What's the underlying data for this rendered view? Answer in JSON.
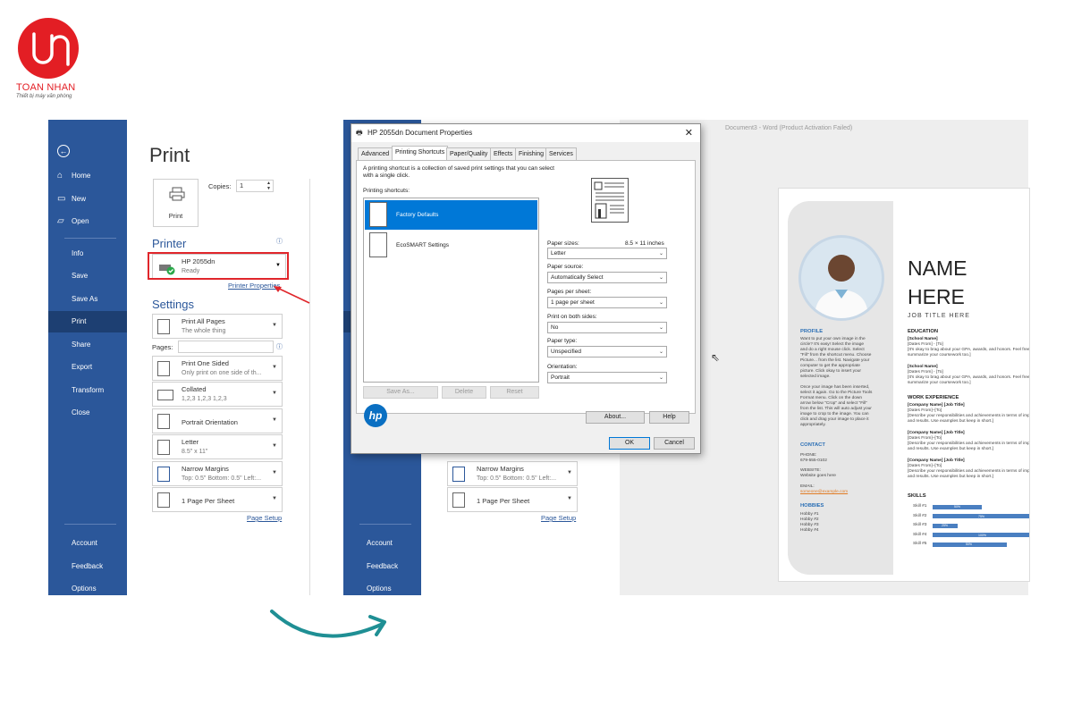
{
  "logo": {
    "brand": "TOAN NHAN",
    "tagline": "Thiết bị máy văn phòng"
  },
  "nav": {
    "home": "Home",
    "new": "New",
    "open": "Open",
    "info": "Info",
    "save": "Save",
    "save_as": "Save As",
    "print": "Print",
    "share": "Share",
    "export": "Export",
    "transform": "Transform",
    "close": "Close",
    "account": "Account",
    "feedback": "Feedback",
    "options": "Options"
  },
  "print": {
    "title": "Print",
    "copies_label": "Copies:",
    "copies_value": "1",
    "print_button": "Print",
    "printer_heading": "Printer",
    "printer_name": "HP 2055dn",
    "printer_status": "Ready",
    "printer_properties": "Printer Properties",
    "settings_heading": "Settings",
    "pages_label": "Pages:",
    "print_what": "Print All Pages",
    "print_what_sub": "The whole thing",
    "sides": "Print One Sided",
    "sides_sub": "Only print on one side of th...",
    "collate": "Collated",
    "collate_sub": "1,2,3    1,2,3    1,2,3",
    "orientation": "Portrait Orientation",
    "paper": "Letter",
    "paper_sub": "8.5\" x 11\"",
    "margins": "Narrow Margins",
    "margins_sub": "Top: 0.5\" Bottom: 0.5\" Left:...",
    "per_sheet": "1 Page Per Sheet",
    "page_setup": "Page Setup"
  },
  "dialog": {
    "title": "HP 2055dn Document Properties",
    "tabs": [
      "Advanced",
      "Printing Shortcuts",
      "Paper/Quality",
      "Effects",
      "Finishing",
      "Services"
    ],
    "description": "A printing shortcut is a collection of saved print settings that you can select",
    "description2": "with a single click.",
    "shortcuts_label": "Printing shortcuts:",
    "shortcuts": [
      "Factory Defaults",
      "EcoSMART Settings"
    ],
    "paper_sizes_label": "Paper sizes:",
    "paper_sizes_dim": "8.5 × 11 inches",
    "paper_sizes_value": "Letter",
    "paper_source_label": "Paper source:",
    "paper_source_value": "Automatically Select",
    "pages_per_sheet_label": "Pages per sheet:",
    "pages_per_sheet_value": "1 page per sheet",
    "both_sides_label": "Print on both sides:",
    "both_sides_value": "No",
    "paper_type_label": "Paper type:",
    "paper_type_value": "Unspecified",
    "orientation_label": "Orientation:",
    "orientation_value": "Portrait",
    "save_as": "Save As...",
    "delete": "Delete",
    "reset": "Reset",
    "about": "About...",
    "help": "Help",
    "ok": "OK",
    "cancel": "Cancel",
    "logo": "hp"
  },
  "word": {
    "title": "Document3  -  Word (Product Activation Failed)"
  },
  "resume": {
    "name1": "NAME",
    "name2": "HERE",
    "job_title": "JOB TITLE HERE",
    "profile_h": "PROFILE",
    "profile_lines": [
      "Want to put your own image in the",
      "circle? It's easy! Select the image",
      "and do a right mouse click. Select",
      "\"Fill\" from the shortcut menu. Choose",
      "Picture... from the list. Navigate your",
      "computer to get the appropriate",
      "picture. Click okay to insert your",
      "selected image.",
      "",
      "Once your image has been inserted,",
      "select it again. Go to the Picture Tools",
      "Format menu. Click on the down",
      "arrow below \"Crop\" and select \"Fill\"",
      "from the list. This will auto adjust your",
      "image to crop to the image. You can",
      "click and drag your image to place it",
      "appropriately."
    ],
    "contact_h": "CONTACT",
    "phone_l": "PHONE:",
    "phone": "679-555-0102",
    "website_l": "WEBSITE:",
    "website": "Website goes here",
    "email_l": "EMAIL:",
    "email": "someone@example.com",
    "hobbies_h": "HOBBIES",
    "hobbies": [
      "Hobby #1",
      "Hobby #2",
      "Hobby #3",
      "Hobby #4"
    ],
    "education_h": "EDUCATION",
    "edu": [
      [
        "[School Name]",
        "[Dates From] - [To]",
        "[It's okay to brag about your GPA, awards, and honors. Feel free to",
        "summarize your coursework too.]"
      ],
      [
        "[School Name]",
        "[Dates From] - [To]",
        "[It's okay to brag about your GPA, awards, and honors. Feel free to",
        "summarize your coursework too.]"
      ]
    ],
    "work_h": "WORK EXPERIENCE",
    "work": [
      [
        "[Company Name]  [Job Title]",
        "[Dates From]–[To]",
        "[Describe your responsibilities and achievements in terms of impact",
        "and results. Use examples but keep in short.]"
      ],
      [
        "[Company Name]  [Job Title]",
        "[Dates From]–[To]",
        "[Describe your responsibilities and achievements in terms of impact",
        "and results. Use examples but keep in short.]"
      ],
      [
        "[Company Name]  [Job Title]",
        "[Dates From]–[To]",
        "[Describe your responsibilities and achievements in terms of impact",
        "and results. Use examples but keep in short.]"
      ]
    ],
    "skills_h": "SKILLS",
    "skills": [
      {
        "label": "Skill #1",
        "pct": 0.5,
        "text": "50%"
      },
      {
        "label": "Skill #2",
        "pct": 1.0,
        "text": "75%"
      },
      {
        "label": "Skill #3",
        "pct": 0.25,
        "text": "25%"
      },
      {
        "label": "Skill #4",
        "pct": 1.0,
        "text": "100%"
      },
      {
        "label": "Skill #5",
        "pct": 0.75,
        "text": "50%"
      }
    ]
  },
  "colors": {
    "word_blue": "#2b579a",
    "highlight_red": "#e0262b",
    "select_blue": "#0078d7",
    "arrow_teal": "#1f8f94"
  }
}
